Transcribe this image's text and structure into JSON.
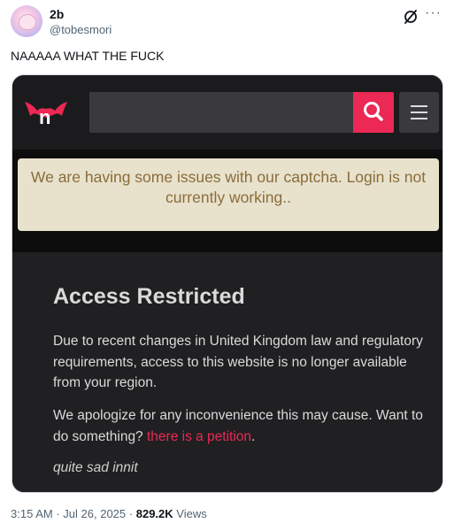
{
  "author": {
    "display_name": "2b",
    "handle": "@tobesmori"
  },
  "tweet": {
    "text": "NAAAAA WHAT THE FUCK",
    "time": "3:15 AM",
    "date": "Jul 26, 2025",
    "views_count": "829.2K",
    "views_label": "Views",
    "separator": "·"
  },
  "icons": {
    "grok": "grok-icon",
    "more": "more-options-icon",
    "search": "search-icon",
    "menu": "hamburger-menu-icon",
    "logo": "bat-wing-n-logo"
  },
  "screenshot": {
    "notice": "We are having some issues with our captcha. Login is not currently working..",
    "title": "Access Restricted",
    "paragraph1": "Due to recent changes in United Kingdom law and regulatory requirements, access to this website is no longer available from your region.",
    "paragraph2_prefix": "We apologize for any inconvenience this may cause. Want to do something?",
    "petition_link": "there is a petition",
    "paragraph2_suffix": ".",
    "note": "quite sad innit"
  },
  "colors": {
    "accent": "#ec2854",
    "notice_bg": "#e8e1cc",
    "notice_text": "#8a6d3b",
    "panel_bg": "#202022"
  }
}
